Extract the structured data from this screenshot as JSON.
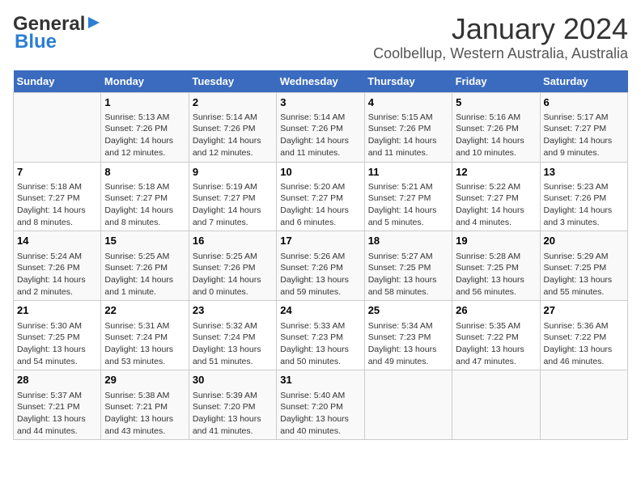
{
  "logo": {
    "text1": "General",
    "text2": "Blue"
  },
  "title": "January 2024",
  "subtitle": "Coolbellup, Western Australia, Australia",
  "headers": [
    "Sunday",
    "Monday",
    "Tuesday",
    "Wednesday",
    "Thursday",
    "Friday",
    "Saturday"
  ],
  "weeks": [
    [
      {
        "day": "",
        "info": ""
      },
      {
        "day": "1",
        "info": "Sunrise: 5:13 AM\nSunset: 7:26 PM\nDaylight: 14 hours\nand 12 minutes."
      },
      {
        "day": "2",
        "info": "Sunrise: 5:14 AM\nSunset: 7:26 PM\nDaylight: 14 hours\nand 12 minutes."
      },
      {
        "day": "3",
        "info": "Sunrise: 5:14 AM\nSunset: 7:26 PM\nDaylight: 14 hours\nand 11 minutes."
      },
      {
        "day": "4",
        "info": "Sunrise: 5:15 AM\nSunset: 7:26 PM\nDaylight: 14 hours\nand 11 minutes."
      },
      {
        "day": "5",
        "info": "Sunrise: 5:16 AM\nSunset: 7:26 PM\nDaylight: 14 hours\nand 10 minutes."
      },
      {
        "day": "6",
        "info": "Sunrise: 5:17 AM\nSunset: 7:27 PM\nDaylight: 14 hours\nand 9 minutes."
      }
    ],
    [
      {
        "day": "7",
        "info": "Sunrise: 5:18 AM\nSunset: 7:27 PM\nDaylight: 14 hours\nand 8 minutes."
      },
      {
        "day": "8",
        "info": "Sunrise: 5:18 AM\nSunset: 7:27 PM\nDaylight: 14 hours\nand 8 minutes."
      },
      {
        "day": "9",
        "info": "Sunrise: 5:19 AM\nSunset: 7:27 PM\nDaylight: 14 hours\nand 7 minutes."
      },
      {
        "day": "10",
        "info": "Sunrise: 5:20 AM\nSunset: 7:27 PM\nDaylight: 14 hours\nand 6 minutes."
      },
      {
        "day": "11",
        "info": "Sunrise: 5:21 AM\nSunset: 7:27 PM\nDaylight: 14 hours\nand 5 minutes."
      },
      {
        "day": "12",
        "info": "Sunrise: 5:22 AM\nSunset: 7:27 PM\nDaylight: 14 hours\nand 4 minutes."
      },
      {
        "day": "13",
        "info": "Sunrise: 5:23 AM\nSunset: 7:26 PM\nDaylight: 14 hours\nand 3 minutes."
      }
    ],
    [
      {
        "day": "14",
        "info": "Sunrise: 5:24 AM\nSunset: 7:26 PM\nDaylight: 14 hours\nand 2 minutes."
      },
      {
        "day": "15",
        "info": "Sunrise: 5:25 AM\nSunset: 7:26 PM\nDaylight: 14 hours\nand 1 minute."
      },
      {
        "day": "16",
        "info": "Sunrise: 5:25 AM\nSunset: 7:26 PM\nDaylight: 14 hours\nand 0 minutes."
      },
      {
        "day": "17",
        "info": "Sunrise: 5:26 AM\nSunset: 7:26 PM\nDaylight: 13 hours\nand 59 minutes."
      },
      {
        "day": "18",
        "info": "Sunrise: 5:27 AM\nSunset: 7:25 PM\nDaylight: 13 hours\nand 58 minutes."
      },
      {
        "day": "19",
        "info": "Sunrise: 5:28 AM\nSunset: 7:25 PM\nDaylight: 13 hours\nand 56 minutes."
      },
      {
        "day": "20",
        "info": "Sunrise: 5:29 AM\nSunset: 7:25 PM\nDaylight: 13 hours\nand 55 minutes."
      }
    ],
    [
      {
        "day": "21",
        "info": "Sunrise: 5:30 AM\nSunset: 7:25 PM\nDaylight: 13 hours\nand 54 minutes."
      },
      {
        "day": "22",
        "info": "Sunrise: 5:31 AM\nSunset: 7:24 PM\nDaylight: 13 hours\nand 53 minutes."
      },
      {
        "day": "23",
        "info": "Sunrise: 5:32 AM\nSunset: 7:24 PM\nDaylight: 13 hours\nand 51 minutes."
      },
      {
        "day": "24",
        "info": "Sunrise: 5:33 AM\nSunset: 7:23 PM\nDaylight: 13 hours\nand 50 minutes."
      },
      {
        "day": "25",
        "info": "Sunrise: 5:34 AM\nSunset: 7:23 PM\nDaylight: 13 hours\nand 49 minutes."
      },
      {
        "day": "26",
        "info": "Sunrise: 5:35 AM\nSunset: 7:22 PM\nDaylight: 13 hours\nand 47 minutes."
      },
      {
        "day": "27",
        "info": "Sunrise: 5:36 AM\nSunset: 7:22 PM\nDaylight: 13 hours\nand 46 minutes."
      }
    ],
    [
      {
        "day": "28",
        "info": "Sunrise: 5:37 AM\nSunset: 7:21 PM\nDaylight: 13 hours\nand 44 minutes."
      },
      {
        "day": "29",
        "info": "Sunrise: 5:38 AM\nSunset: 7:21 PM\nDaylight: 13 hours\nand 43 minutes."
      },
      {
        "day": "30",
        "info": "Sunrise: 5:39 AM\nSunset: 7:20 PM\nDaylight: 13 hours\nand 41 minutes."
      },
      {
        "day": "31",
        "info": "Sunrise: 5:40 AM\nSunset: 7:20 PM\nDaylight: 13 hours\nand 40 minutes."
      },
      {
        "day": "",
        "info": ""
      },
      {
        "day": "",
        "info": ""
      },
      {
        "day": "",
        "info": ""
      }
    ]
  ]
}
